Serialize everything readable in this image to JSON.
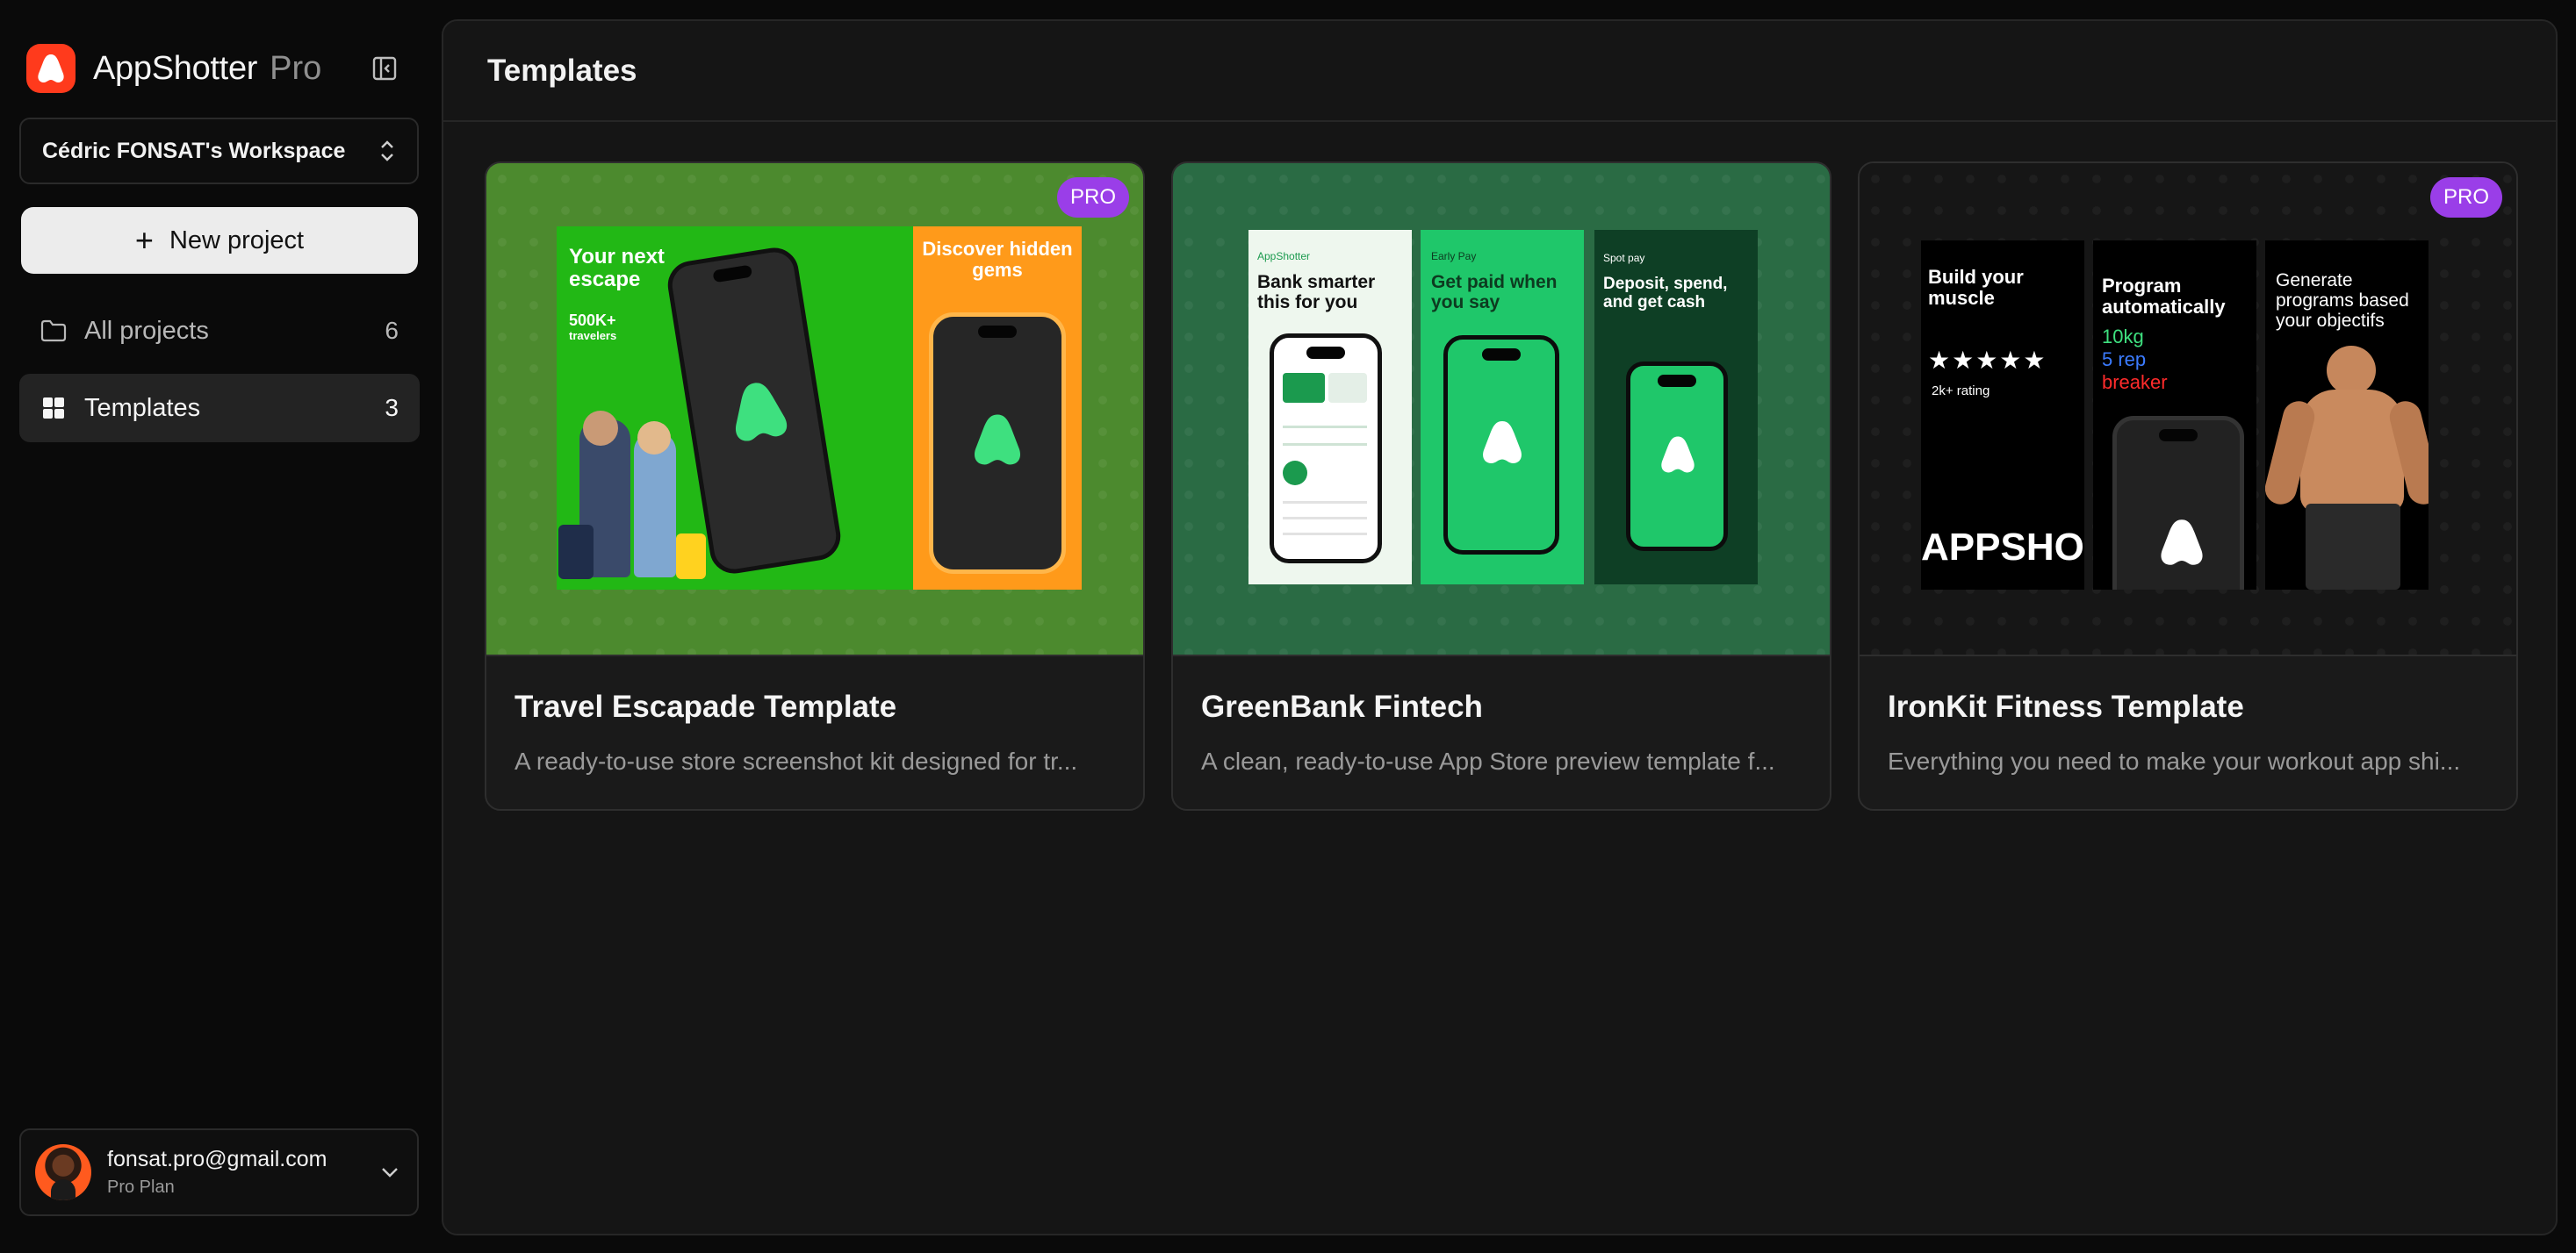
{
  "brand": {
    "name": "AppShotter",
    "tier": "Pro"
  },
  "workspace": {
    "name": "Cédric FONSAT's Workspace"
  },
  "sidebar": {
    "new_project_label": "New project",
    "items": [
      {
        "label": "All projects",
        "count": "6",
        "icon": "folder-icon"
      },
      {
        "label": "Templates",
        "count": "3",
        "icon": "grid-icon",
        "active": true
      }
    ]
  },
  "user": {
    "email": "fonsat.pro@gmail.com",
    "plan": "Pro Plan"
  },
  "main": {
    "title": "Templates",
    "templates": [
      {
        "title": "Travel Escapade Template",
        "description": "A ready-to-use store screenshot kit designed for tr...",
        "badge": "PRO",
        "preview": {
          "panel1_title": "Your next escape",
          "panel1_stat": "500K+",
          "panel1_stat_label": "travelers",
          "panel3_title": "Discover hidden gems"
        }
      },
      {
        "title": "GreenBank Fintech",
        "description": "A clean, ready-to-use App Store preview template f...",
        "preview": {
          "panel1_kicker": "AppShotter",
          "panel1_title": "Bank smarter this for you",
          "panel2_kicker": "Early Pay",
          "panel2_title": "Get paid when you say",
          "panel3_kicker": "Spot pay",
          "panel3_title": "Deposit, spend, and get cash"
        }
      },
      {
        "title": "IronKit Fitness Template",
        "description": "Everything you need to make your workout app shi...",
        "badge": "PRO",
        "preview": {
          "panel1_title": "Build your muscle",
          "panel1_stars": "★★★★★",
          "panel1_rating": "2k+ rating",
          "panel1_brand": "APPSHOT",
          "panel2_title": "Program automatically",
          "panel2_line1": "10kg",
          "panel2_line2": "5 rep",
          "panel2_line3": "breaker",
          "panel3_title": "Generate programs based your objectifs"
        }
      }
    ]
  },
  "colors": {
    "brand": "#ff3a1c",
    "pro_badge": "#9a3ee8",
    "travel_green": "#22b815",
    "travel_orange": "#ff9a1a",
    "bank_green": "#1fc76a",
    "accent_green": "#3ee07f"
  }
}
